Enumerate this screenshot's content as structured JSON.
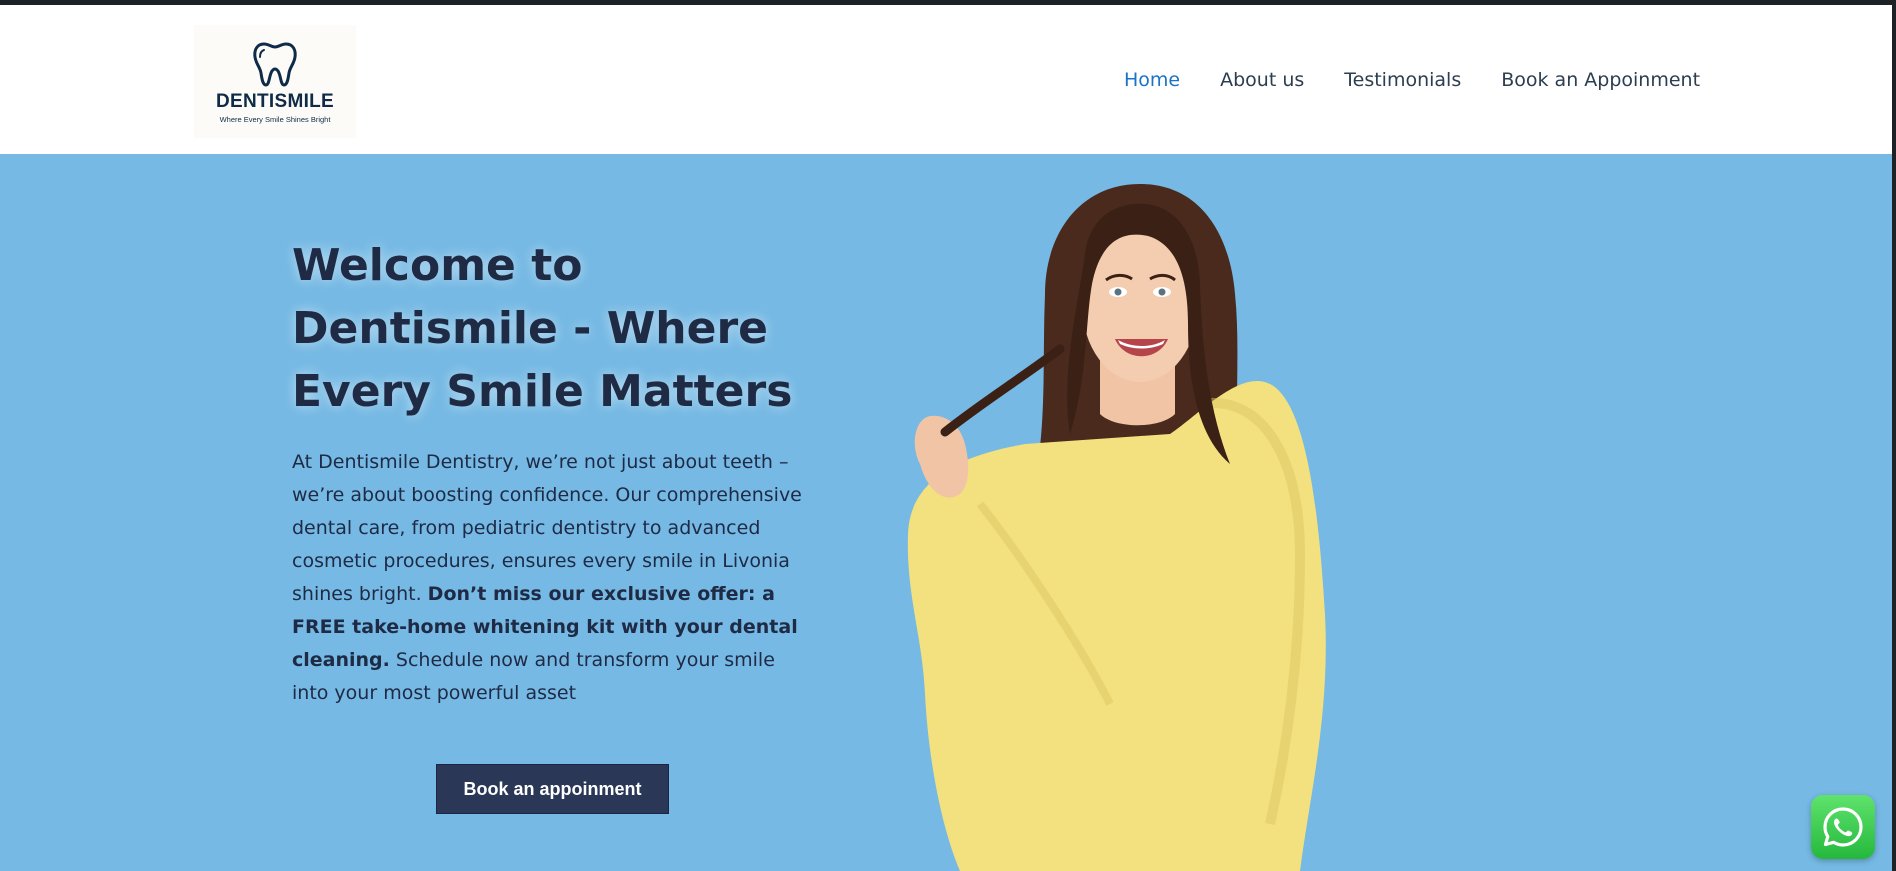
{
  "header": {
    "logo": {
      "name": "DENTISMILE",
      "tagline": "Where Every Smile Shines Bright",
      "icon": "tooth-icon"
    },
    "nav": [
      {
        "label": "Home",
        "active": true
      },
      {
        "label": "About us",
        "active": false
      },
      {
        "label": "Testimonials",
        "active": false
      },
      {
        "label": "Book an Appoinment",
        "active": false
      }
    ]
  },
  "hero": {
    "title": "Welcome to Dentismile - Where Every Smile Matters",
    "text_intro": "At Dentismile Dentistry, we’re not just about teeth – we’re about boosting confidence. Our comprehensive dental care, from pediatric dentistry to advanced cosmetic procedures, ensures every smile in Livonia shines bright. ",
    "text_bold": "Don’t miss our exclusive offer: a FREE take-home whitening kit with your dental cleaning.",
    "text_outro": " Schedule now and transform your smile into your most powerful asset",
    "cta_label": "Book an appoinment",
    "image": "smiling-woman-in-yellow-sweater"
  },
  "floating": {
    "whatsapp_icon": "whatsapp-icon"
  },
  "colors": {
    "hero_bg": "#75b9e4",
    "nav_active": "#1a73c8",
    "cta_bg": "#2a3757",
    "heading": "#1f2a44",
    "whatsapp": "#25b83d"
  }
}
